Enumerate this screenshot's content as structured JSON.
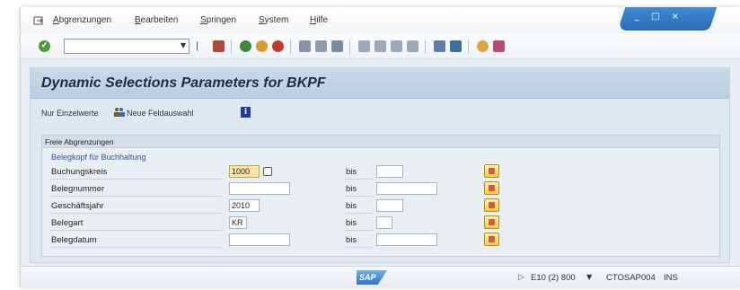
{
  "menubar": {
    "items": [
      "Abgrenzungen",
      "Bearbeiten",
      "Springen",
      "System",
      "Hilfe"
    ],
    "window_controls": "_ □ ×"
  },
  "toolbar": {
    "command_field_value": "",
    "ok_icon": "check-circle-icon"
  },
  "screen": {
    "title": "Dynamic Selections Parameters for BKPF",
    "app_buttons": {
      "single_values": "Nur Einzelwerte",
      "new_field_selection": "Neue Feldauswahl"
    }
  },
  "group": {
    "header": "Freie Abgrenzungen",
    "section_label": "Belegkopf für Buchhaltung",
    "bis_label": "bis",
    "fields": [
      {
        "label": "Buchungskreis",
        "from": "1000",
        "to": "",
        "required": true
      },
      {
        "label": "Belegnummer",
        "from": "",
        "to": "",
        "required": false
      },
      {
        "label": "Geschäftsjahr",
        "from": "2010",
        "to": "",
        "required": false
      },
      {
        "label": "Belegart",
        "from": "KR",
        "to": "",
        "required": false
      },
      {
        "label": "Belegdatum",
        "from": "",
        "to": "",
        "required": false
      }
    ]
  },
  "statusbar": {
    "logo": "SAP",
    "system": "E10 (2) 800",
    "server": "CTOSAP004",
    "mode": "INS"
  },
  "colors": {
    "accent": "#2b55b0",
    "title_bar": "#c9dae8",
    "required_field": "#fbe5a8"
  }
}
